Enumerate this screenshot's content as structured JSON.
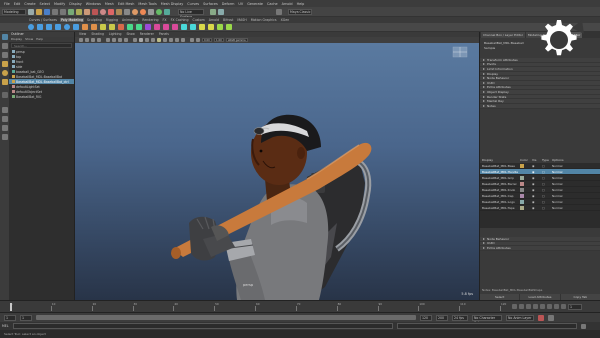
{
  "menubar": {
    "items": [
      "File",
      "Edit",
      "Create",
      "Select",
      "Modify",
      "Display",
      "Windows",
      "Mesh",
      "Edit Mesh",
      "Mesh Tools",
      "Mesh Display",
      "Curves",
      "Surfaces",
      "Deform",
      "UV",
      "Generate",
      "Cache",
      "Arnold",
      "Help"
    ]
  },
  "status": {
    "mode": "Modeling",
    "workspace": "Maya Classic",
    "symmetry": "No Live Surface",
    "input_field": "Symmetry: Off"
  },
  "shelf": {
    "tabs": [
      "Curves / Surfaces",
      "Poly Modeling",
      "Sculpting",
      "Rigging",
      "Animation",
      "Rendering",
      "FX",
      "FX Caching",
      "Custom",
      "Arnold",
      "Bifrost",
      "MASH",
      "Motion Graphics",
      "XGen"
    ],
    "active_index": 1
  },
  "outliner": {
    "title": "Outliner",
    "menu": [
      "Display",
      "Show",
      "Help"
    ],
    "search_placeholder": "Search...",
    "items": [
      "persp",
      "top",
      "front",
      "side",
      "baseball_bat_GEO",
      "BaseballBat_MDL:BaseballBat",
      "BaseballBat_MDL:BaseballBat_ctrl",
      "defaultLightSet",
      "defaultObjectSet",
      "BaseballBat_RIG"
    ],
    "selected_index": 6
  },
  "viewport": {
    "menu": [
      "View",
      "Shading",
      "Lighting",
      "Show",
      "Renderer",
      "Panels"
    ],
    "camera": "persp",
    "fps": "5.8 fps",
    "field_value": "0.00",
    "gamma": "1.00",
    "colorspace": "sRGB gamma"
  },
  "attribute_editor": {
    "tabs": [
      "Channel Box / Layer Editor",
      "Modeling Toolkit",
      "Attribute Editor"
    ],
    "active_tab": 2,
    "node_name": "BaseballBat_MDL:Baseball",
    "node_type": "Sample",
    "sections": [
      "Transform Attributes",
      "Pivots",
      "Limit Information",
      "Display",
      "Node Behavior",
      "UUID",
      "Extra Attributes",
      "Object Display",
      "Render Stats",
      "Mental Ray",
      "Notes"
    ],
    "layer_headers": [
      "Display",
      "Color",
      "Vis",
      "Type",
      "Options"
    ],
    "layers": [
      {
        "name": "BaseballBat_MDL:Base",
        "type": "Normal",
        "sel": false
      },
      {
        "name": "BaseballBat_MDL:Handle",
        "type": "Normal",
        "sel": true
      },
      {
        "name": "BaseballBat_MDL:Grip",
        "type": "Normal",
        "sel": false
      },
      {
        "name": "BaseballBat_MDL:Barrel",
        "type": "Normal",
        "sel": false
      },
      {
        "name": "BaseballBat_MDL:Knob",
        "type": "Normal",
        "sel": false
      },
      {
        "name": "BaseballBat_MDL:Cap",
        "type": "Normal",
        "sel": false
      },
      {
        "name": "BaseballBat_MDL:Logo",
        "type": "Normal",
        "sel": false
      },
      {
        "name": "BaseballBat_MDL:Tape",
        "type": "Normal",
        "sel": false
      }
    ],
    "lower_sections": [
      "Node Behavior",
      "UUID",
      "Extra Attributes"
    ],
    "notes_label": "Notes: BaseballBat_MDL:BaseballBatShape",
    "bottom_buttons": [
      "Select",
      "Load Attributes",
      "Copy Tab"
    ]
  },
  "timeline": {
    "ticks": [
      "1",
      "10",
      "20",
      "30",
      "40",
      "50",
      "60",
      "70",
      "80",
      "90",
      "100",
      "110",
      "120"
    ],
    "current_frame": "1",
    "start": "1",
    "end": "120",
    "range_end": "200",
    "character_set": "No Character Set",
    "anim_layer": "No Anim Layer",
    "fps": "24 fps"
  },
  "cmdline": {
    "lang": "MEL",
    "help_text": "Select Tool: select an object"
  },
  "colors": {
    "bat": "#c87a3c",
    "skin": "#6a3418",
    "selection": "#5285a6"
  }
}
